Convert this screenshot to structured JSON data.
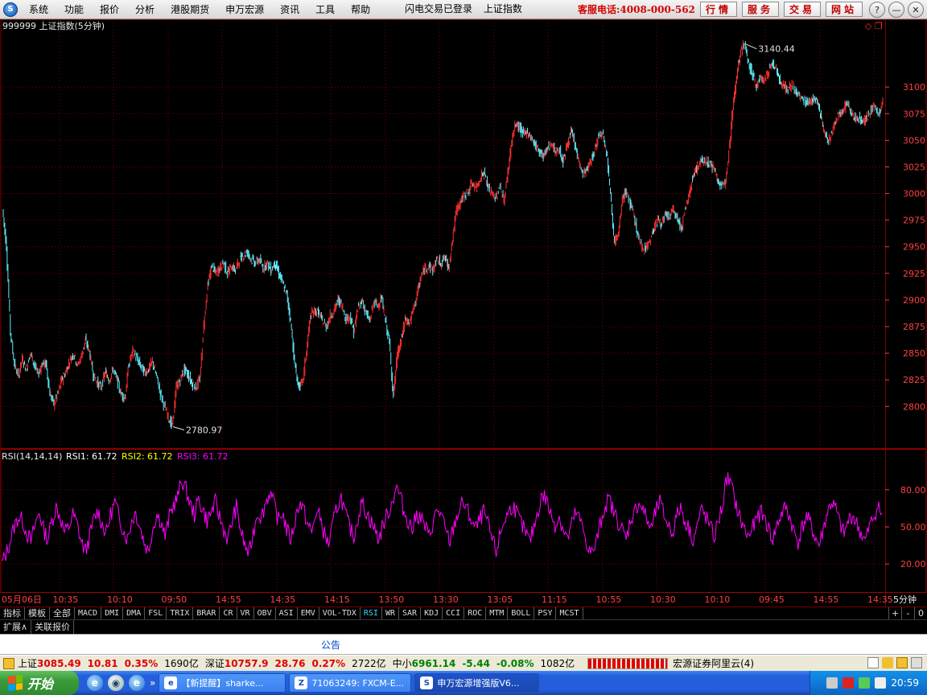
{
  "menubar": {
    "items": [
      "系统",
      "功能",
      "报价",
      "分析",
      "港股期货",
      "申万宏源",
      "资讯",
      "工具",
      "帮助"
    ],
    "center": [
      "闪电交易已登录",
      "上证指数"
    ],
    "hotline": "客服电话:4008-000-562",
    "nav_buttons": [
      "行情",
      "服务",
      "交易",
      "网站"
    ],
    "window_buttons": [
      "?",
      "—",
      "❐",
      "✕"
    ]
  },
  "chart_data": [
    {
      "type": "line",
      "title": "999999 上证指数(5分钟)",
      "ylabel": "",
      "ylim": [
        2770,
        3150
      ],
      "y_ticks": [
        2800,
        2825,
        2850,
        2875,
        2900,
        2925,
        2950,
        2975,
        3000,
        3025,
        3050,
        3075,
        3100
      ],
      "annotations": [
        {
          "label": "3140.44",
          "kind": "max",
          "value": 3140.44
        },
        {
          "label": "2780.97",
          "kind": "min",
          "value": 2780.97
        }
      ],
      "x_ticks": [
        "05月06日",
        "10:35",
        "10:10",
        "09:50",
        "14:55",
        "14:35",
        "14:15",
        "13:50",
        "13:30",
        "13:05",
        "11:15",
        "10:55",
        "10:30",
        "10:10",
        "09:45",
        "14:55",
        "14:35"
      ],
      "x_right_label": "5分钟",
      "series": [
        {
          "values": [
            2985,
            2950,
            2870,
            2840,
            2828,
            2845,
            2835,
            2850,
            2840,
            2830,
            2840,
            2840,
            2812,
            2802,
            2812,
            2825,
            2832,
            2843,
            2850,
            2838,
            2848,
            2862,
            2852,
            2830,
            2822,
            2818,
            2832,
            2825,
            2835,
            2825,
            2812,
            2808,
            2840,
            2852,
            2845,
            2838,
            2832,
            2835,
            2842,
            2828,
            2812,
            2800,
            2790,
            2781,
            2818,
            2825,
            2835,
            2830,
            2822,
            2818,
            2826,
            2878,
            2915,
            2932,
            2925,
            2930,
            2935,
            2925,
            2932,
            2928,
            2938,
            2942,
            2945,
            2938,
            2935,
            2938,
            2930,
            2935,
            2928,
            2935,
            2925,
            2915,
            2905,
            2880,
            2840,
            2818,
            2822,
            2852,
            2885,
            2890,
            2888,
            2880,
            2875,
            2885,
            2890,
            2900,
            2895,
            2882,
            2885,
            2870,
            2892,
            2900,
            2888,
            2880,
            2898,
            2895,
            2902,
            2880,
            2860,
            2810,
            2848,
            2862,
            2882,
            2878,
            2890,
            2905,
            2922,
            2930,
            2932,
            2928,
            2938,
            2935,
            2940,
            2930,
            2958,
            2985,
            2992,
            2998,
            3002,
            3010,
            3005,
            3015,
            3020,
            3005,
            3000,
            2995,
            3008,
            2992,
            3020,
            3050,
            3065,
            3062,
            3055,
            3058,
            3052,
            3045,
            3040,
            3035,
            3042,
            3048,
            3038,
            3042,
            3030,
            3045,
            3058,
            3045,
            3030,
            3018,
            3022,
            3030,
            3040,
            3055,
            3058,
            3040,
            3000,
            2955,
            2960,
            2995,
            3002,
            2990,
            2978,
            2960,
            2948,
            2950,
            2955,
            2968,
            2975,
            2972,
            2980,
            2978,
            2985,
            2975,
            2968,
            2985,
            3000,
            3018,
            3025,
            3030,
            3032,
            3028,
            3025,
            3015,
            3005,
            3010,
            3040,
            3080,
            3112,
            3135,
            3140,
            3122,
            3112,
            3100,
            3110,
            3105,
            3115,
            3122,
            3118,
            3105,
            3100,
            3098,
            3102,
            3095,
            3090,
            3088,
            3085,
            3088,
            3090,
            3078,
            3060,
            3048,
            3055,
            3068,
            3075,
            3080,
            3085,
            3075,
            3070,
            3072,
            3068,
            3072,
            3078,
            3082,
            3075,
            3085
          ]
        }
      ]
    },
    {
      "type": "line",
      "title": "RSI(14,14,14)",
      "ylim": [
        0,
        100
      ],
      "y_ticks": [
        20,
        50,
        80
      ],
      "y_tick_labels": [
        "20.00",
        "50.00",
        "80.00"
      ],
      "legend": [
        {
          "name": "RSI1:",
          "value": "61.72",
          "color": "#ffffff"
        },
        {
          "name": "RSI2:",
          "value": "61.72",
          "color": "#ffff00"
        },
        {
          "name": "RSI3:",
          "value": "61.72",
          "color": "#ff00ff"
        }
      ],
      "series": [
        {
          "color": "#ff00ff",
          "values": [
            20,
            28,
            38,
            50,
            58,
            55,
            45,
            38,
            52,
            62,
            48,
            40,
            55,
            66,
            58,
            45,
            50,
            60,
            52,
            38,
            30,
            42,
            56,
            63,
            52,
            45,
            60,
            70,
            58,
            48,
            40,
            55,
            62,
            50,
            38,
            30,
            48,
            60,
            55,
            42,
            58,
            68,
            74,
            88,
            80,
            68,
            60,
            72,
            64,
            55,
            62,
            70,
            58,
            48,
            40,
            55,
            66,
            48,
            35,
            28,
            45,
            62,
            58,
            70,
            78,
            68,
            55,
            62,
            48,
            40,
            55,
            70,
            64,
            52,
            45,
            62,
            58,
            44,
            36,
            52,
            66,
            74,
            60,
            50,
            42,
            58,
            70,
            62,
            55,
            48,
            40,
            52,
            60,
            68,
            82,
            76,
            62,
            55,
            48,
            60,
            58,
            50,
            42,
            55,
            64,
            58,
            45,
            38,
            52,
            62,
            70,
            64,
            56,
            48,
            55,
            62,
            52,
            40,
            30,
            45,
            56,
            62,
            68,
            60,
            52,
            45,
            38,
            50,
            64,
            76,
            72,
            60,
            52,
            58,
            48,
            40,
            52,
            62,
            55,
            45,
            32,
            28,
            40,
            55,
            68,
            72,
            62,
            55,
            48,
            40,
            56,
            62,
            70,
            64,
            55,
            48,
            62,
            70,
            60,
            52,
            45,
            58,
            66,
            55,
            48,
            40,
            52,
            64,
            58,
            50,
            42,
            55,
            68,
            90,
            84,
            70,
            58,
            50,
            42,
            48,
            55,
            62,
            58,
            48,
            40,
            52,
            60,
            66,
            58,
            46,
            38,
            50,
            58,
            52,
            42,
            35,
            48,
            62,
            70,
            64,
            52,
            44,
            55,
            60,
            52,
            45,
            38,
            50,
            58,
            66,
            60
          ]
        }
      ]
    }
  ],
  "indicator_tabs": [
    "指标",
    "模板",
    "全部",
    "MACD",
    "DMI",
    "DMA",
    "FSL",
    "TRIX",
    "BRAR",
    "CR",
    "VR",
    "OBV",
    "ASI",
    "EMV",
    "VOL-TDX",
    "RSI",
    "WR",
    "SAR",
    "KDJ",
    "CCI",
    "ROC",
    "MTM",
    "BOLL",
    "PSY",
    "MCST"
  ],
  "indicator_active": "RSI",
  "indicator_right": [
    "+",
    "-",
    "0"
  ],
  "ext_tabs": [
    "扩展∧",
    "关联报价"
  ],
  "notice": "公告",
  "status": {
    "sh_label": "上证",
    "sh_value": "3085.49",
    "sh_change": "10.81",
    "sh_pct": "0.35%",
    "sh_amount": "1690亿",
    "sz_label": "深证",
    "sz_value": "10757.9",
    "sz_change": "28.76",
    "sz_pct": "0.27%",
    "sz_amount": "2722亿",
    "zx_label": "中小",
    "zx_value": "6961.14",
    "zx_change": "-5.44",
    "zx_pct": "-0.08%",
    "zx_amount": "1082亿",
    "broker": "宏源证券阿里云(4)"
  },
  "taskbar": {
    "start": "开始",
    "windows": [
      "【新提醒】sharke...",
      "71063249: FXCM-E...",
      "申万宏源增强版V6..."
    ],
    "clock": "20:59"
  },
  "colors": {
    "grid": "#7a0000",
    "price_up": "#ff3030",
    "price_down": "#5cf0ff",
    "axis_text": "#ff4040",
    "rsi": "#ff00ff"
  }
}
